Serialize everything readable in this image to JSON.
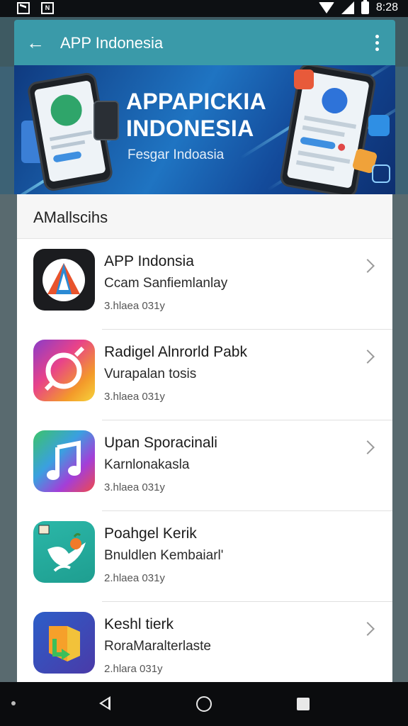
{
  "status_bar": {
    "time": "8:28"
  },
  "app_bar": {
    "title": "APP Indonesia",
    "back_icon": "arrow-back-icon",
    "menu_icon": "more-vert-icon"
  },
  "banner": {
    "title_line1": "APPAPICKIA",
    "title_line2": "INDONESIA",
    "subtitle": "Fesgar Indoasia"
  },
  "section": {
    "title": "AMallscihs"
  },
  "apps": [
    {
      "title": "APP Indonsia",
      "subtitle": "Ccam Sanfiemlanlay",
      "meta": "3.hlaea 031y",
      "icon": "triangle-logo-icon"
    },
    {
      "title": "Radigel Alnrorld Pabk",
      "subtitle": "Vurapalan tosis",
      "meta": "3.hlaea 031y",
      "icon": "gradient-ring-icon"
    },
    {
      "title": "Upan Sporacinali",
      "subtitle": "Karnlonakasla",
      "meta": "3.hlaea 031y",
      "icon": "music-note-icon"
    },
    {
      "title": "Poahgel Kerik",
      "subtitle": "Bnuldlen Kembaiarl'",
      "meta": "2.hlaea 031y",
      "icon": "bird-icon"
    },
    {
      "title": "Keshl tierk",
      "subtitle": "RoraMaralterlaste",
      "meta": "2.hlara 031y",
      "icon": "arrow-down-logo-icon"
    }
  ],
  "colors": {
    "app_bar": "#3a9aa9",
    "banner": "#1f74c2",
    "nav_bar": "#0b0c0e"
  }
}
